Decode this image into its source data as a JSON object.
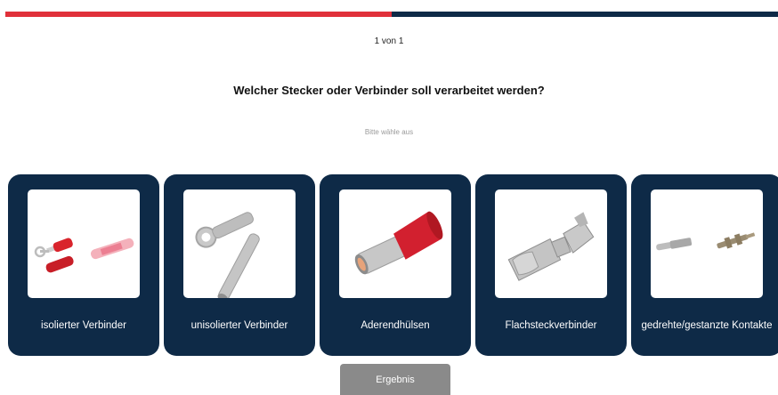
{
  "progress": {
    "fraction": 0.5,
    "fill_color": "#e0303a",
    "track_color": "#0e2a47"
  },
  "step_indicator": "1 von 1",
  "question": "Welcher Stecker oder Verbinder soll verarbeitet werden?",
  "hint": "Bitte wähle aus",
  "options": [
    {
      "label": "isolierter Verbinder",
      "icon": "insulated-connector-icon"
    },
    {
      "label": "unisolierter Verbinder",
      "icon": "uninsulated-connector-icon"
    },
    {
      "label": "Aderendhülsen",
      "icon": "wire-end-ferrule-icon"
    },
    {
      "label": "Flachsteckverbinder",
      "icon": "flat-plug-connector-icon"
    },
    {
      "label": "gedrehte/gestanzte Kontakte",
      "icon": "turned-stamped-contact-icon"
    }
  ],
  "result_button": "Ergebnis",
  "colors": {
    "card_background": "#0e2a47",
    "button_background": "#8a8a8a"
  }
}
